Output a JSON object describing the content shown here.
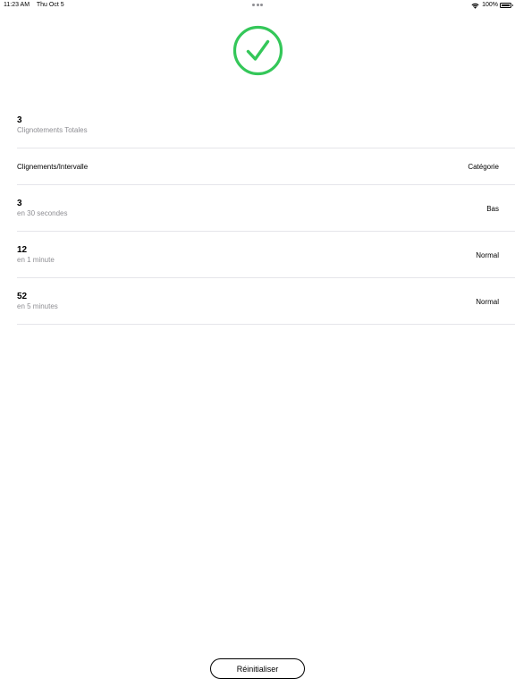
{
  "status_bar": {
    "time": "11:23 AM",
    "date": "Thu Oct 5",
    "battery": "100%"
  },
  "status_icon": {
    "name": "checkmark-circle-icon",
    "color": "#34c759"
  },
  "total": {
    "value": "3",
    "label": "Clignotements Totales"
  },
  "table": {
    "header_left": "Clignements/Intervalle",
    "header_right": "Catégorie",
    "rows": [
      {
        "value": "3",
        "interval": "en 30 secondes",
        "category": "Bas"
      },
      {
        "value": "12",
        "interval": "en 1 minute",
        "category": "Normal"
      },
      {
        "value": "52",
        "interval": "en 5 minutes",
        "category": "Normal"
      }
    ]
  },
  "reset_button": {
    "label": "Réinitialiser"
  }
}
